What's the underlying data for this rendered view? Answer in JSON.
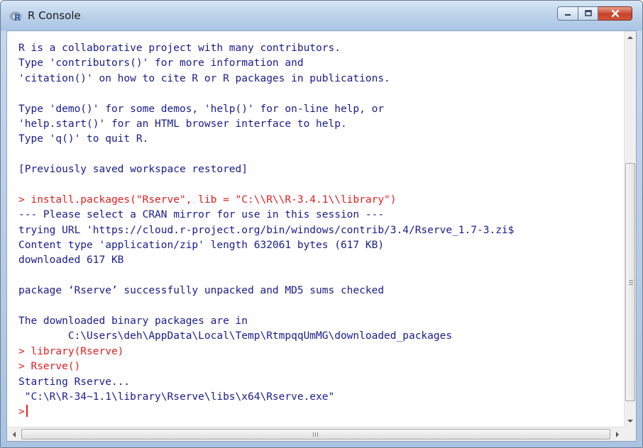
{
  "window": {
    "title": "R Console",
    "icon": "r-logo-icon",
    "controls": [
      "minimize-icon",
      "maximize-icon",
      "close-icon"
    ]
  },
  "console": {
    "lines": [
      {
        "kind": "output",
        "text": "R is a collaborative project with many contributors."
      },
      {
        "kind": "output",
        "text": "Type 'contributors()' for more information and"
      },
      {
        "kind": "output",
        "text": "'citation()' on how to cite R or R packages in publications."
      },
      {
        "kind": "output",
        "text": ""
      },
      {
        "kind": "output",
        "text": "Type 'demo()' for some demos, 'help()' for on-line help, or"
      },
      {
        "kind": "output",
        "text": "'help.start()' for an HTML browser interface to help."
      },
      {
        "kind": "output",
        "text": "Type 'q()' to quit R."
      },
      {
        "kind": "output",
        "text": ""
      },
      {
        "kind": "output",
        "text": "[Previously saved workspace restored]"
      },
      {
        "kind": "output",
        "text": ""
      },
      {
        "kind": "input",
        "text": "> install.packages(\"Rserve\", lib = \"C:\\\\R\\\\R-3.4.1\\\\library\")"
      },
      {
        "kind": "output",
        "text": "--- Please select a CRAN mirror for use in this session ---"
      },
      {
        "kind": "output",
        "text": "trying URL 'https://cloud.r-project.org/bin/windows/contrib/3.4/Rserve_1.7-3.zi$"
      },
      {
        "kind": "output",
        "text": "Content type 'application/zip' length 632061 bytes (617 KB)"
      },
      {
        "kind": "output",
        "text": "downloaded 617 KB"
      },
      {
        "kind": "output",
        "text": ""
      },
      {
        "kind": "output",
        "text": "package ‘Rserve’ successfully unpacked and MD5 sums checked"
      },
      {
        "kind": "output",
        "text": ""
      },
      {
        "kind": "output",
        "text": "The downloaded binary packages are in"
      },
      {
        "kind": "output",
        "text": "        C:\\Users\\deh\\AppData\\Local\\Temp\\RtmpqqUmMG\\downloaded_packages"
      },
      {
        "kind": "input",
        "text": "> library(Rserve)"
      },
      {
        "kind": "input",
        "text": "> Rserve()"
      },
      {
        "kind": "output",
        "text": "Starting Rserve..."
      },
      {
        "kind": "output",
        "text": " \"C:\\R\\R-34~1.1\\library\\Rserve\\libs\\x64\\Rserve.exe\""
      }
    ],
    "prompt": ">",
    "colors": {
      "output": "#1a1a8c",
      "input": "#e02020",
      "background": "#ffffff"
    }
  },
  "scrollbars": {
    "vertical": {
      "up": "arrow-up-icon",
      "down": "arrow-down-icon",
      "grip": "grip-icon"
    },
    "horizontal": {
      "left": "arrow-left-icon",
      "right": "arrow-right-icon",
      "grip": "grip-icon"
    }
  }
}
